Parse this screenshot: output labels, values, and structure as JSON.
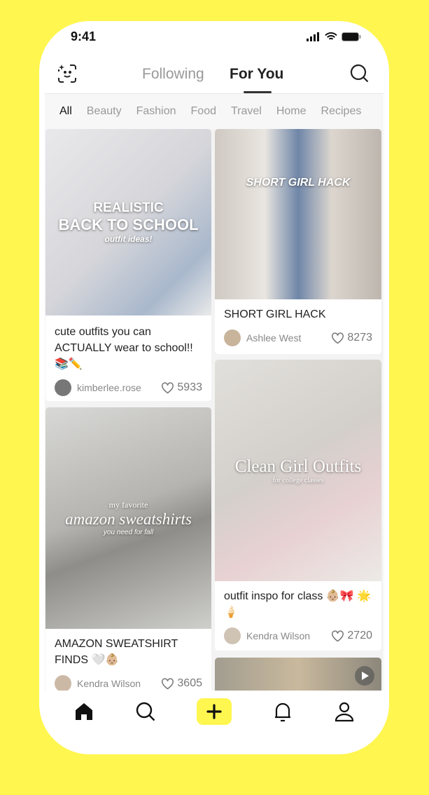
{
  "status": {
    "time": "9:41"
  },
  "header": {
    "tabs": [
      {
        "label": "Following"
      },
      {
        "label": "For You"
      }
    ],
    "active_tab": "For You"
  },
  "categories": [
    "All",
    "Beauty",
    "Fashion",
    "Food",
    "Travel",
    "Home",
    "Recipes"
  ],
  "active_category": "All",
  "posts": [
    {
      "overlay": [
        "REALISTIC",
        "BACK TO SCHOOL",
        "outfit ideas!"
      ],
      "title": "cute outfits you can ACTUALLY wear to school!! 📚✏️",
      "author": "kimberlee.rose",
      "likes": "5933"
    },
    {
      "overlay": [
        "my favorite",
        "amazon sweatshirts",
        "you need for fall"
      ],
      "title": "AMAZON SWEATSHIRT FINDS 🤍👶🏼",
      "author": "Kendra Wilson",
      "likes": "3605"
    },
    {
      "overlay": [
        "SHORT GIRL HACK"
      ],
      "title": "SHORT GIRL HACK",
      "author": "Ashlee West",
      "likes": "8273"
    },
    {
      "overlay": [
        "Clean Girl Outfits",
        "for college classes"
      ],
      "title": "outfit inspo for class 👶🏼🎀 🌟🍦",
      "author": "Kendra Wilson",
      "likes": "2720"
    }
  ],
  "colors": {
    "brand": "#fff64f",
    "text": "#222222",
    "muted": "#999999"
  }
}
